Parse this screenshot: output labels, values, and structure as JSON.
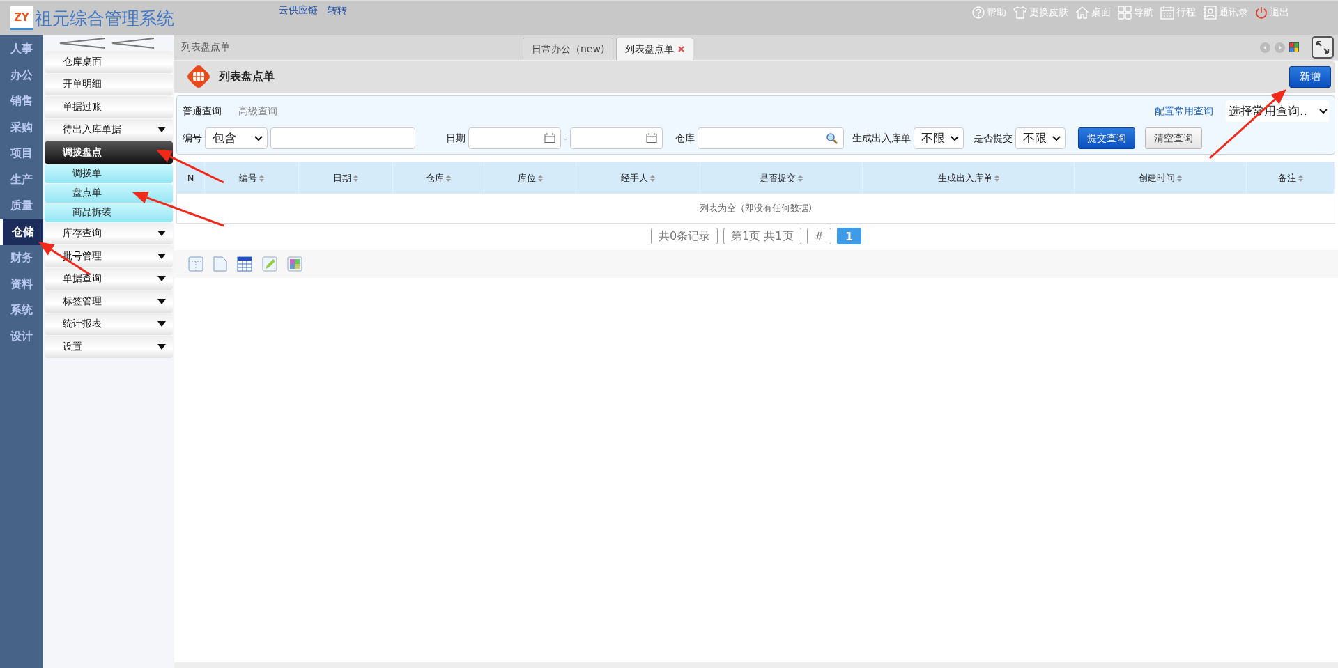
{
  "app": {
    "title": "祖元综合管理系统",
    "logo_text": "ZY",
    "top_links": [
      "云供应链",
      "转转"
    ],
    "toolbar": [
      {
        "kind": "help",
        "label": "帮助"
      },
      {
        "kind": "skin",
        "label": "更换皮肤"
      },
      {
        "kind": "home",
        "label": "桌面"
      },
      {
        "kind": "nav",
        "label": "导航"
      },
      {
        "kind": "calendar",
        "label": "行程"
      },
      {
        "kind": "contacts",
        "label": "通讯录"
      },
      {
        "kind": "power",
        "label": "退出"
      }
    ]
  },
  "nav_modules": [
    {
      "label": "人事",
      "selected": false
    },
    {
      "label": "办公",
      "selected": false
    },
    {
      "label": "销售",
      "selected": false
    },
    {
      "label": "采购",
      "selected": false
    },
    {
      "label": "项目",
      "selected": false
    },
    {
      "label": "生产",
      "selected": false
    },
    {
      "label": "质量",
      "selected": false
    },
    {
      "label": "仓储",
      "selected": true
    },
    {
      "label": "财务",
      "selected": false
    },
    {
      "label": "资料",
      "selected": false
    },
    {
      "label": "系统",
      "selected": false
    },
    {
      "label": "设计",
      "selected": false
    }
  ],
  "sidebar": {
    "items": [
      {
        "kind": "link",
        "label": "仓库桌面"
      },
      {
        "kind": "link",
        "label": "开单明细"
      },
      {
        "kind": "link",
        "label": "单据过账"
      },
      {
        "kind": "group",
        "label": "待出入库单据",
        "expanded": false
      },
      {
        "kind": "group",
        "label": "调拨盘点",
        "expanded": true,
        "children": [
          {
            "label": "调拨单"
          },
          {
            "label": "盘点单"
          },
          {
            "label": "商品拆装"
          }
        ]
      },
      {
        "kind": "group",
        "label": "库存查询",
        "expanded": false
      },
      {
        "kind": "group",
        "label": "批号管理",
        "expanded": false
      },
      {
        "kind": "group",
        "label": "单据查询",
        "expanded": false
      },
      {
        "kind": "group",
        "label": "标签管理",
        "expanded": false
      },
      {
        "kind": "group",
        "label": "统计报表",
        "expanded": false
      },
      {
        "kind": "group",
        "label": "设置",
        "expanded": false
      }
    ]
  },
  "breadcrumb": "列表盘点单",
  "tabs": [
    {
      "label": "日常办公（new)",
      "selected": false,
      "closable": false
    },
    {
      "label": "列表盘点单",
      "selected": true,
      "closable": true
    }
  ],
  "page": {
    "title": "列表盘点单",
    "add_button": "新增"
  },
  "filter": {
    "modes": [
      {
        "label": "普通查询",
        "selected": true
      },
      {
        "label": "高级查询",
        "selected": false
      }
    ],
    "config_link": "配置常用查询",
    "saved_query": {
      "value": "选择常用查询.."
    },
    "code": {
      "label": "编号",
      "operator": "包含"
    },
    "date": {
      "label": "日期",
      "separator": "-"
    },
    "warehouse": {
      "label": "仓库"
    },
    "generated": {
      "label": "生成出入库单",
      "value": "不限"
    },
    "submitted": {
      "label": "是否提交",
      "value": "不限"
    },
    "submit_button": "提交查询",
    "clear_button": "清空查询"
  },
  "table": {
    "columns": [
      "N",
      "编号",
      "日期",
      "仓库",
      "库位",
      "经手人",
      "是否提交",
      "生成出入库单",
      "创建时间",
      "备注"
    ],
    "empty_text": "列表为空（即没有任何数据)"
  },
  "pagination": {
    "total": "共0条记录",
    "pages": "第1页 共1页",
    "jump": "#",
    "current": "1"
  }
}
